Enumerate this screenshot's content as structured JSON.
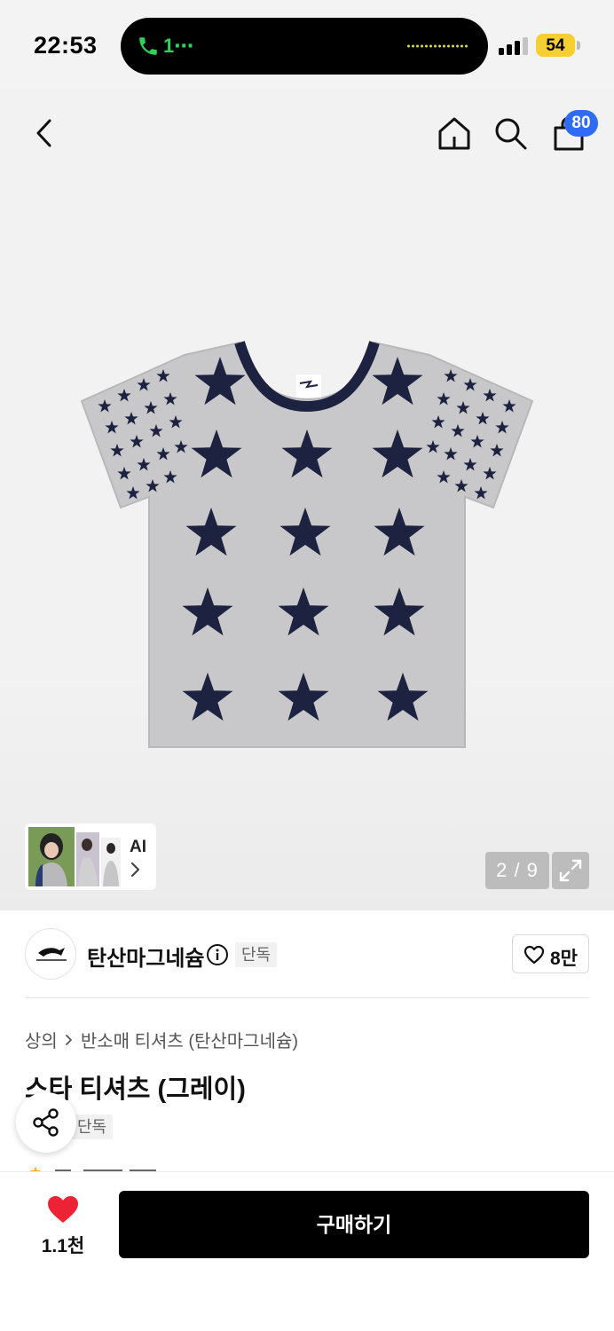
{
  "status_bar": {
    "time": "22:53",
    "call_indicator": "1⋯",
    "battery": "54",
    "accent_call": "#2fd158",
    "battery_color": "#f6cf33"
  },
  "header": {
    "icons": [
      "back-icon",
      "home-icon",
      "search-icon",
      "cart-icon"
    ],
    "cart_count": "80",
    "badge_color": "#2f6cf6"
  },
  "gallery": {
    "ai_label": "AI",
    "image_counter": "2 / 9"
  },
  "brand": {
    "name": "탄산마그네슘",
    "badge": "단독",
    "like_count": "8만"
  },
  "product": {
    "breadcrumb": [
      "상의",
      "반소매 티셔츠 (탄산마그네슘)"
    ],
    "title": "스타 티셔츠 (그레이)",
    "badge": "단독"
  },
  "bottom_bar": {
    "heart_count": "1.1천",
    "buy_label": "구매하기",
    "heart_color": "#ee2235"
  }
}
